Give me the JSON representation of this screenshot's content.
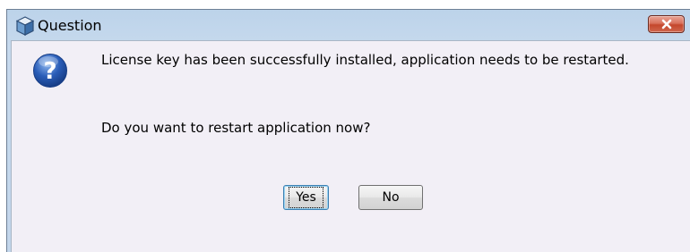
{
  "window": {
    "title": "Question",
    "app_icon": "app-cube-icon",
    "close_icon": "close-icon"
  },
  "dialog": {
    "icon": "question-icon",
    "message_line1": "License key has been successfully installed, application needs to be restarted.",
    "message_line2": "Do you want to restart application now?"
  },
  "buttons": {
    "yes_label": "Yes",
    "no_label": "No"
  },
  "colors": {
    "close_button": "#c4472c",
    "question_icon": "#2a5db8",
    "client_background": "#f2eff6"
  }
}
